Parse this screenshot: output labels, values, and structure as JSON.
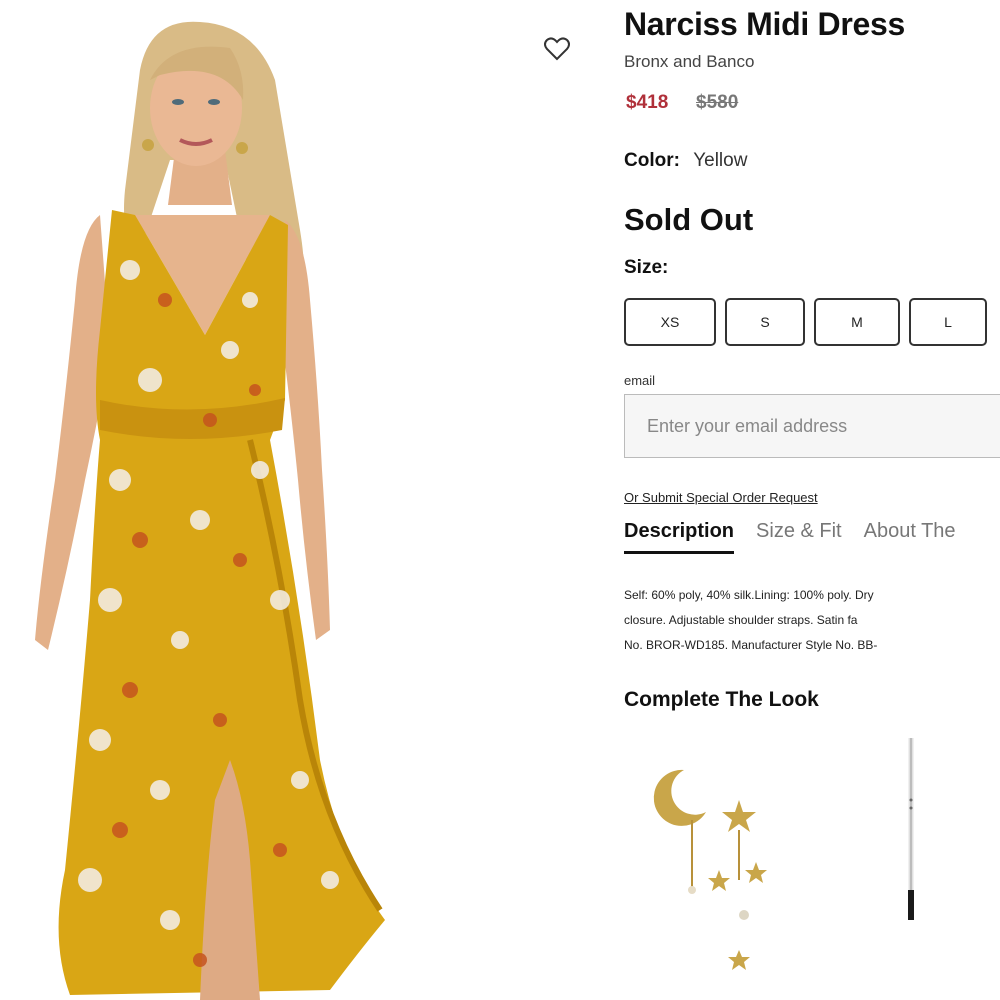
{
  "product": {
    "title": "Narciss Midi Dress",
    "brand": "Bronx and Banco",
    "price_sale": "$418",
    "price_original": "$580",
    "color_label": "Color:",
    "color_value": "Yellow",
    "availability": "Sold Out",
    "size_label": "Size:",
    "sizes": [
      "XS",
      "S",
      "M",
      "L"
    ]
  },
  "email": {
    "label": "email",
    "placeholder": "Enter your email address"
  },
  "special_order_link": "Or Submit Special Order Request",
  "tabs": [
    "Description",
    "Size & Fit",
    "About The"
  ],
  "description_lines": [
    "Self: 60% poly, 40% silk.Lining: 100% poly. Dry",
    "closure. Adjustable shoulder straps. Satin fa",
    "No. BROR-WD185. Manufacturer Style No. BB-"
  ],
  "complete_the_look": {
    "title": "Complete The Look",
    "items": [
      "moon-star-earrings",
      "eyeliner-pencil"
    ]
  },
  "icons": {
    "wishlist": "heart-icon"
  },
  "colors": {
    "sale_price": "#b0303a",
    "dress_yellow": "#d9a615",
    "background": "#ffffff"
  }
}
